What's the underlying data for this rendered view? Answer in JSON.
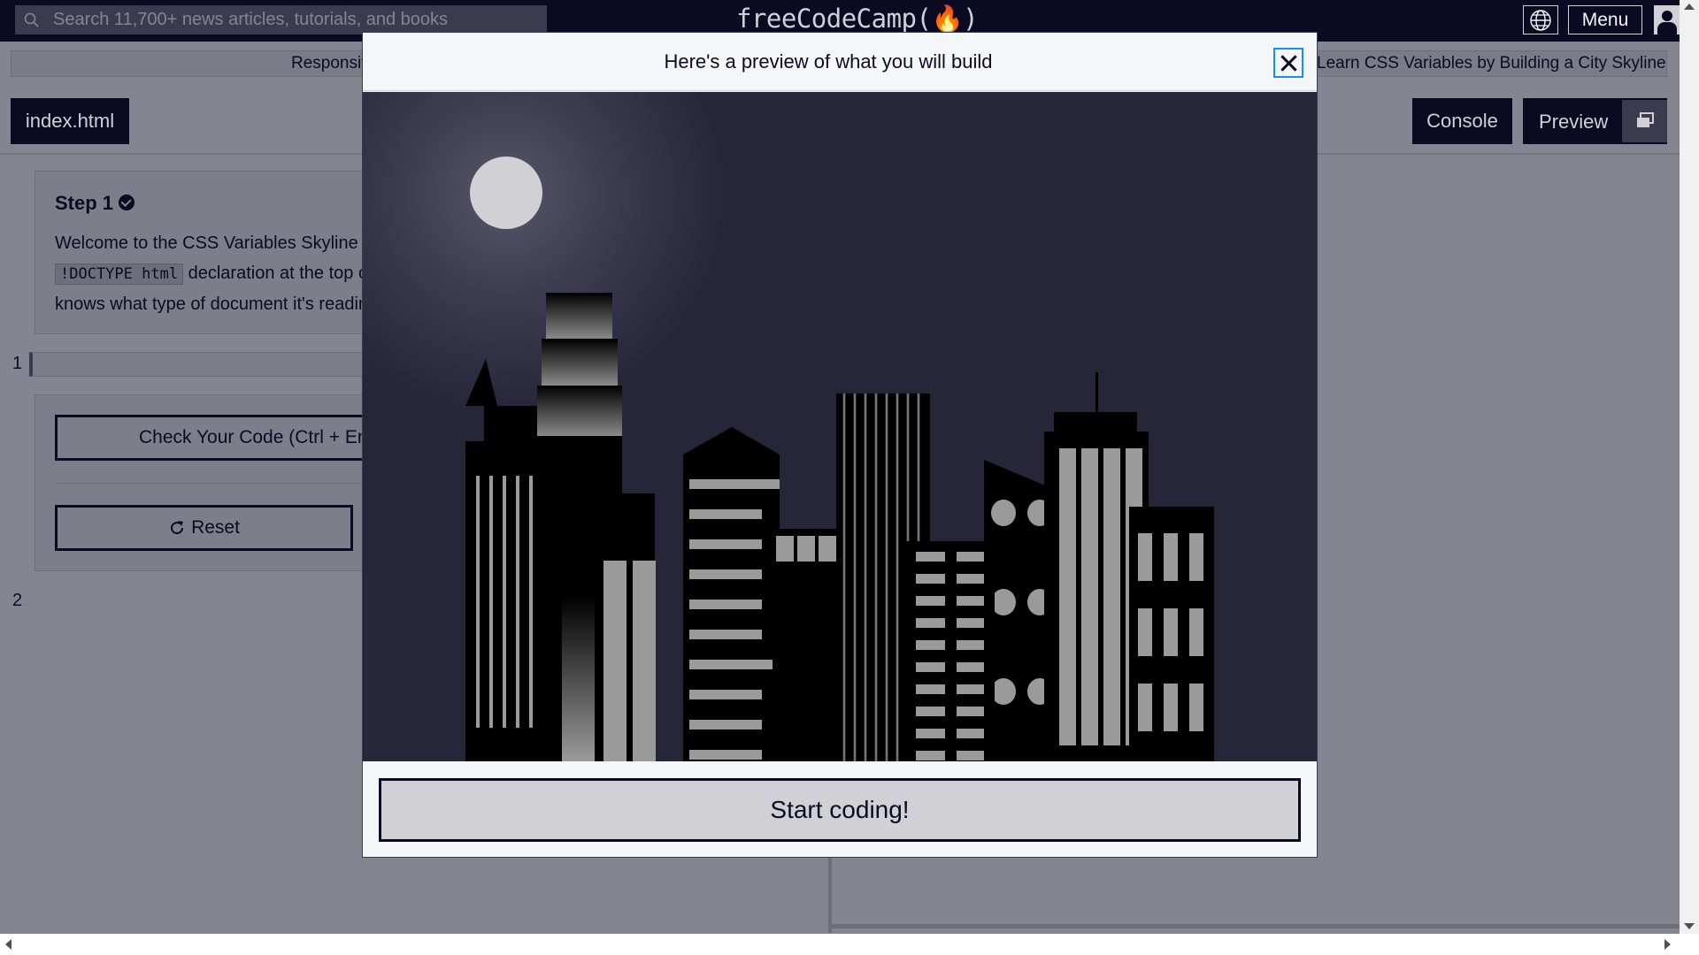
{
  "nav": {
    "search_placeholder": "Search 11,700+ news articles, tutorials, and books",
    "brand": "freeCodeCamp(🔥)",
    "menu_label": "Menu"
  },
  "breadcrumb": {
    "course": "Responsive Web Design",
    "project": "Learn CSS Variables by Building a City Skyline"
  },
  "toolbar": {
    "file_tab": "index.html",
    "console_label": "Console",
    "preview_label": "Preview"
  },
  "step": {
    "title": "Step 1",
    "text_line1": "Welcome to the CSS Variables Skyline project! Start by adding the",
    "code": "!DOCTYPE html",
    "text_line2_rest": " declaration at the top of the page so the browser",
    "text_line3": "knows what type of document it's reading."
  },
  "editor": {
    "line_numbers": [
      "1",
      "2"
    ]
  },
  "actions": {
    "check_label": "Check Your Code (Ctrl + Enter)",
    "reset_label": "Reset"
  },
  "modal": {
    "title": "Here's a preview of what you will build",
    "start_label": "Start coding!"
  },
  "colors": {
    "nav_bg": "#0a0a23",
    "dim_overlay": "#858592",
    "sky": "#272639",
    "moon": "#d0d0d5",
    "focus": "#198eee"
  }
}
